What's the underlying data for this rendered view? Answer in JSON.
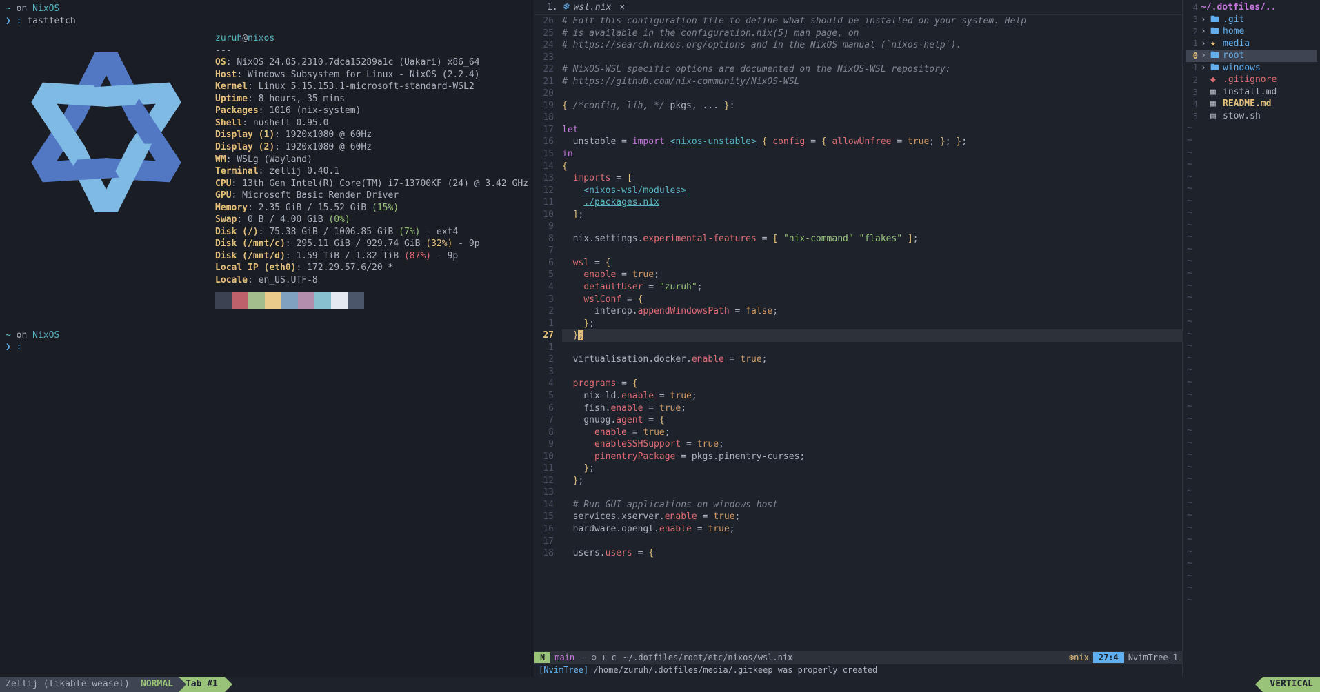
{
  "terminal": {
    "prompt1": {
      "tilde": "~",
      "on": " on ",
      "os": "NixOS"
    },
    "prompt_char": "❯ : ",
    "command": "fastfetch",
    "fastfetch": {
      "user": "zuruh",
      "at": "@",
      "host": "nixos",
      "separator": "---",
      "rows": [
        {
          "label": "OS",
          "value": ": NixOS 24.05.2310.7dca15289a1c (Uakari) x86_64"
        },
        {
          "label": "Host",
          "value": ": Windows Subsystem for Linux - NixOS (2.2.4)"
        },
        {
          "label": "Kernel",
          "value": ": Linux 5.15.153.1-microsoft-standard-WSL2"
        },
        {
          "label": "Uptime",
          "value": ": 8 hours, 35 mins"
        },
        {
          "label": "Packages",
          "value": ": 1016 (nix-system)"
        },
        {
          "label": "Shell",
          "value": ": nushell 0.95.0"
        },
        {
          "label": "Display (1)",
          "value": ": 1920x1080 @ 60Hz"
        },
        {
          "label": "Display (2)",
          "value": ": 1920x1080 @ 60Hz"
        },
        {
          "label": "WM",
          "value": ": WSLg (Wayland)"
        },
        {
          "label": "Terminal",
          "value": ": zellij 0.40.1"
        },
        {
          "label": "CPU",
          "value": ": 13th Gen Intel(R) Core(TM) i7-13700KF (24) @ 3.42 GHz"
        },
        {
          "label": "GPU",
          "value": ": Microsoft Basic Render Driver"
        },
        {
          "label": "Memory",
          "value": ": 2.35 GiB / 15.52 GiB ",
          "pct": "(15%)",
          "pctClass": "pct-green"
        },
        {
          "label": "Swap",
          "value": ": 0 B / 4.00 GiB ",
          "pct": "(0%)",
          "pctClass": "pct-green"
        },
        {
          "label": "Disk (/)",
          "value": ": 75.38 GiB / 1006.85 GiB ",
          "pct": "(7%)",
          "pctClass": "pct-green",
          "suffix": " - ext4"
        },
        {
          "label": "Disk (/mnt/c)",
          "value": ": 295.11 GiB / 929.74 GiB ",
          "pct": "(32%)",
          "pctClass": "pct-yellow",
          "suffix": " - 9p"
        },
        {
          "label": "Disk (/mnt/d)",
          "value": ": 1.59 TiB / 1.82 TiB ",
          "pct": "(87%)",
          "pctClass": "pct-red",
          "suffix": " - 9p"
        },
        {
          "label": "Local IP (eth0)",
          "value": ": 172.29.57.6/20 *"
        },
        {
          "label": "Locale",
          "value": ": en_US.UTF-8"
        }
      ],
      "colors": [
        "#3b4252",
        "#bf616a",
        "#a3be8c",
        "#ebcb8b",
        "#81a1c1",
        "#b48ead",
        "#88c0d0",
        "#e5e9f0",
        "#4c566a",
        "#d08770",
        "#8fbcbb",
        "#d8dee9",
        "#5e81ac",
        "#a3506c",
        "#6fa8a0",
        "#eceff4"
      ]
    }
  },
  "editor": {
    "tab": {
      "num": "1.",
      "icon": "❄",
      "name": "wsl.nix",
      "close": "×"
    },
    "lines": [
      {
        "n": "26",
        "html": "<span class='c-comment'># Edit this configuration file to define what should be installed on your system. Help</span>"
      },
      {
        "n": "25",
        "html": "<span class='c-comment'># is available in the configuration.nix(5) man page, on</span>"
      },
      {
        "n": "24",
        "html": "<span class='c-comment'># https://search.nixos.org/options and in the NixOS manual (`nixos-help`).</span>"
      },
      {
        "n": "23",
        "html": ""
      },
      {
        "n": "22",
        "html": "<span class='c-comment'># NixOS-WSL specific options are documented on the NixOS-WSL repository:</span>"
      },
      {
        "n": "21",
        "html": "<span class='c-comment'># https://github.com/nix-community/NixOS-WSL</span>"
      },
      {
        "n": "20",
        "html": ""
      },
      {
        "n": "19",
        "html": "<span class='c-brace'>{</span> <span class='c-comment'>/*config, lib, */</span> <span class='c-ident'>pkgs</span><span class='c-punct'>,</span> <span class='c-punct'>...</span> <span class='c-brace'>}</span><span class='c-punct'>:</span>"
      },
      {
        "n": "18",
        "html": ""
      },
      {
        "n": "17",
        "html": "<span class='c-keyword'>let</span>"
      },
      {
        "n": "16",
        "html": "  <span class='c-ident'>unstable</span> <span class='c-punct'>=</span> <span class='c-keyword'>import</span> <span class='c-link'>&lt;nixos-unstable&gt;</span> <span class='c-brace'>{</span> <span class='c-attr'>config</span> <span class='c-punct'>=</span> <span class='c-brace'>{</span> <span class='c-attr'>allowUnfree</span> <span class='c-punct'>=</span> <span class='c-bool'>true</span><span class='c-punct'>;</span> <span class='c-brace'>}</span><span class='c-punct'>;</span> <span class='c-brace'>}</span><span class='c-punct'>;</span>"
      },
      {
        "n": "15",
        "html": "<span class='c-keyword'>in</span>"
      },
      {
        "n": "14",
        "html": "<span class='c-brace'>{</span>"
      },
      {
        "n": "13",
        "html": "  <span class='c-attr'>imports</span> <span class='c-punct'>=</span> <span class='c-brace'>[</span>"
      },
      {
        "n": "12",
        "html": "    <span class='c-link'>&lt;nixos-wsl/modules&gt;</span>"
      },
      {
        "n": "11",
        "html": "    <span class='c-link'>./packages.nix</span>"
      },
      {
        "n": "10",
        "html": "  <span class='c-brace'>]</span><span class='c-punct'>;</span>"
      },
      {
        "n": "9",
        "html": ""
      },
      {
        "n": "8",
        "html": "  <span class='c-ident'>nix</span><span class='c-punct'>.</span><span class='c-ident'>settings</span><span class='c-punct'>.</span><span class='c-attr'>experimental-features</span> <span class='c-punct'>=</span> <span class='c-brace'>[</span> <span class='c-string'>\"nix-command\"</span> <span class='c-string'>\"flakes\"</span> <span class='c-brace'>]</span><span class='c-punct'>;</span>"
      },
      {
        "n": "7",
        "html": ""
      },
      {
        "n": "6",
        "html": "  <span class='c-attr'>wsl</span> <span class='c-punct'>=</span> <span class='c-brace'>{</span>"
      },
      {
        "n": "5",
        "html": "    <span class='c-attr'>enable</span> <span class='c-punct'>=</span> <span class='c-bool'>true</span><span class='c-punct'>;</span>"
      },
      {
        "n": "4",
        "html": "    <span class='c-attr'>defaultUser</span> <span class='c-punct'>=</span> <span class='c-string'>\"zuruh\"</span><span class='c-punct'>;</span>"
      },
      {
        "n": "3",
        "html": "    <span class='c-attr'>wslConf</span> <span class='c-punct'>=</span> <span class='c-brace'>{</span>"
      },
      {
        "n": "2",
        "html": "      <span class='c-ident'>interop</span><span class='c-punct'>.</span><span class='c-attr'>appendWindowsPath</span> <span class='c-punct'>=</span> <span class='c-bool'>false</span><span class='c-punct'>;</span>"
      },
      {
        "n": "1",
        "html": "    <span class='c-brace'>}</span><span class='c-punct'>;</span>"
      },
      {
        "n": "27",
        "cur": true,
        "html": "  <span class='c-brace'>}</span><span style='background:#e5c07b;color:#1e222a'>;</span>"
      },
      {
        "n": "1",
        "html": ""
      },
      {
        "n": "2",
        "html": "  <span class='c-ident'>virtualisation</span><span class='c-punct'>.</span><span class='c-ident'>docker</span><span class='c-punct'>.</span><span class='c-attr'>enable</span> <span class='c-punct'>=</span> <span class='c-bool'>true</span><span class='c-punct'>;</span>"
      },
      {
        "n": "3",
        "html": ""
      },
      {
        "n": "4",
        "html": "  <span class='c-attr'>programs</span> <span class='c-punct'>=</span> <span class='c-brace'>{</span>"
      },
      {
        "n": "5",
        "html": "    <span class='c-ident'>nix-ld</span><span class='c-punct'>.</span><span class='c-attr'>enable</span> <span class='c-punct'>=</span> <span class='c-bool'>true</span><span class='c-punct'>;</span>"
      },
      {
        "n": "6",
        "html": "    <span class='c-ident'>fish</span><span class='c-punct'>.</span><span class='c-attr'>enable</span> <span class='c-punct'>=</span> <span class='c-bool'>true</span><span class='c-punct'>;</span>"
      },
      {
        "n": "7",
        "html": "    <span class='c-ident'>gnupg</span><span class='c-punct'>.</span><span class='c-attr'>agent</span> <span class='c-punct'>=</span> <span class='c-brace'>{</span>"
      },
      {
        "n": "8",
        "html": "      <span class='c-attr'>enable</span> <span class='c-punct'>=</span> <span class='c-bool'>true</span><span class='c-punct'>;</span>"
      },
      {
        "n": "9",
        "html": "      <span class='c-attr'>enableSSHSupport</span> <span class='c-punct'>=</span> <span class='c-bool'>true</span><span class='c-punct'>;</span>"
      },
      {
        "n": "10",
        "html": "      <span class='c-attr'>pinentryPackage</span> <span class='c-punct'>=</span> <span class='c-ident'>pkgs</span><span class='c-punct'>.</span><span class='c-ident'>pinentry-curses</span><span class='c-punct'>;</span>"
      },
      {
        "n": "11",
        "html": "    <span class='c-brace'>}</span><span class='c-punct'>;</span>"
      },
      {
        "n": "12",
        "html": "  <span class='c-brace'>}</span><span class='c-punct'>;</span>"
      },
      {
        "n": "13",
        "html": ""
      },
      {
        "n": "14",
        "html": "  <span class='c-comment'># Run GUI applications on windows host</span>"
      },
      {
        "n": "15",
        "html": "  <span class='c-ident'>services</span><span class='c-punct'>.</span><span class='c-ident'>xserver</span><span class='c-punct'>.</span><span class='c-attr'>enable</span> <span class='c-punct'>=</span> <span class='c-bool'>true</span><span class='c-punct'>;</span>"
      },
      {
        "n": "16",
        "html": "  <span class='c-ident'>hardware</span><span class='c-punct'>.</span><span class='c-ident'>opengl</span><span class='c-punct'>.</span><span class='c-attr'>enable</span> <span class='c-punct'>=</span> <span class='c-bool'>true</span><span class='c-punct'>;</span>"
      },
      {
        "n": "17",
        "html": ""
      },
      {
        "n": "18",
        "html": "  <span class='c-ident'>users</span><span class='c-punct'>.</span><span class='c-attr'>users</span> <span class='c-punct'>=</span> <span class='c-brace'>{</span>"
      }
    ],
    "statusline": {
      "mode": "N",
      "branch": " main",
      "git": " - ⊙ + c",
      "path": "~/.dotfiles/root/etc/nixos/wsl.nix",
      "ft": "❄nix",
      "pos": "27:4",
      "tree": "NvimTree_1"
    },
    "message": {
      "tag": "[NvimTree]",
      "text": " /home/zuruh/.dotfiles/media/.gitkeep was properly created"
    }
  },
  "tree": {
    "header": "~/.dotfiles/..",
    "header_num": "4",
    "items": [
      {
        "n": "3",
        "chev": "›",
        "icon": "folder",
        "name": ".git",
        "cls": "tree-name"
      },
      {
        "n": "2",
        "chev": "›",
        "icon": "folder",
        "name": "home",
        "cls": "tree-name"
      },
      {
        "n": "1",
        "chev": "›",
        "icon": "star",
        "name": "media",
        "cls": "tree-name"
      },
      {
        "n": "0",
        "chev": "›",
        "icon": "folder",
        "name": "root",
        "cls": "tree-name",
        "cur": true,
        "sel": true
      },
      {
        "n": "1",
        "chev": "›",
        "icon": "folder",
        "name": "windows",
        "cls": "tree-name"
      },
      {
        "n": "2",
        "chev": " ",
        "icon": "git",
        "name": ".gitignore",
        "cls": "tree-name git"
      },
      {
        "n": "3",
        "chev": " ",
        "icon": "md",
        "name": "install.md",
        "cls": "tree-name file"
      },
      {
        "n": "4",
        "chev": " ",
        "icon": "md",
        "name": "README.md",
        "cls": "tree-name special"
      },
      {
        "n": "5",
        "chev": " ",
        "icon": "sh",
        "name": "stow.sh",
        "cls": "tree-name file"
      }
    ]
  },
  "bottombar": {
    "zellij": "Zellij (likable-weasel)",
    "mode": "NORMAL",
    "tab": "Tab #1",
    "right": "VERTICAL"
  }
}
